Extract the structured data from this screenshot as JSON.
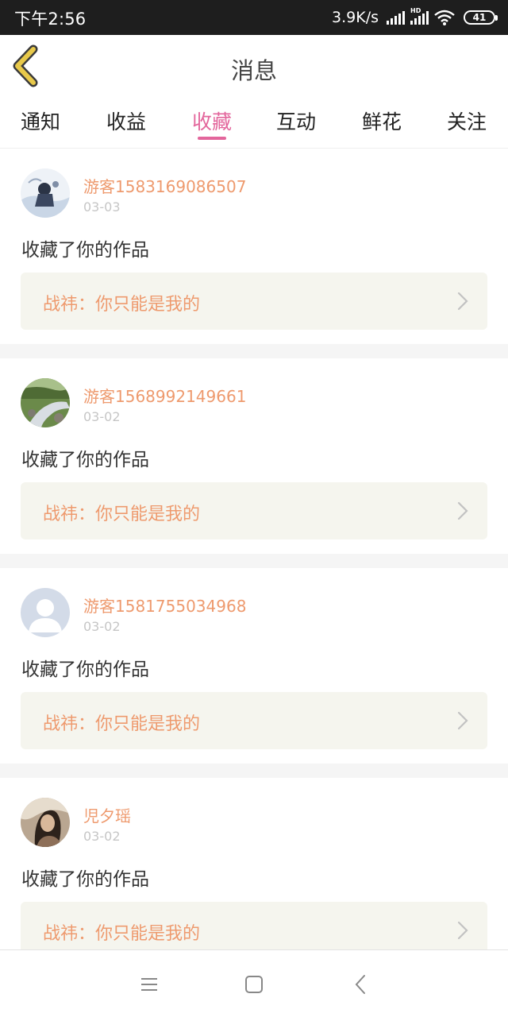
{
  "status_bar": {
    "time": "下午2:56",
    "speed": "3.9K/s",
    "hd": "HD",
    "battery": "41"
  },
  "header": {
    "title": "消息"
  },
  "tabs": [
    {
      "label": "通知",
      "active": false
    },
    {
      "label": "收益",
      "active": false
    },
    {
      "label": "收藏",
      "active": true
    },
    {
      "label": "互动",
      "active": false
    },
    {
      "label": "鲜花",
      "active": false
    },
    {
      "label": "关注",
      "active": false
    }
  ],
  "feed": [
    {
      "username": "游客1583169086507",
      "date": "03-03",
      "action": "收藏了你的作品",
      "work": "战祎：你只能是我的",
      "avatar": "blue-white-photo"
    },
    {
      "username": "游客1568992149661",
      "date": "03-02",
      "action": "收藏了你的作品",
      "work": "战祎：你只能是我的",
      "avatar": "stream-landscape-photo"
    },
    {
      "username": "游客1581755034968",
      "date": "03-02",
      "action": "收藏了你的作品",
      "work": "战祎：你只能是我的",
      "avatar": "default-avatar"
    },
    {
      "username": "児夕瑶",
      "date": "03-02",
      "action": "收藏了你的作品",
      "work": "战祎：你只能是我的",
      "avatar": "portrait-photo"
    }
  ],
  "colors": {
    "accent": "#e3669c",
    "username": "#ee9a6e",
    "back_arrow": "#e8c94a",
    "card_bg": "#f5f5ee"
  },
  "nav": {
    "icons": [
      "menu-icon",
      "home-icon",
      "back-icon"
    ]
  }
}
